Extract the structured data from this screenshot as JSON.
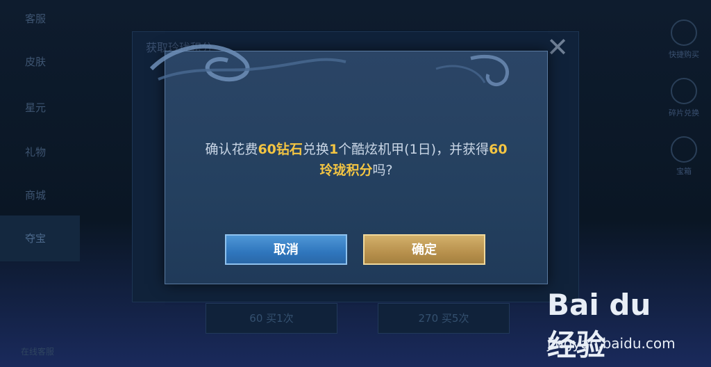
{
  "background": {
    "left_menu": [
      "客服",
      "皮肤",
      "星元",
      "礼物",
      "商城",
      "夺宝"
    ],
    "left_menu_active": "夺宝",
    "left_footer": "在线客服",
    "panel_title": "获取玲珑积分",
    "buttons": [
      "60 买1次",
      "270 买5次"
    ],
    "right_rail": [
      "快捷购买",
      "碎片兑换",
      "宝箱"
    ]
  },
  "dialog": {
    "message": {
      "p1": "确认花费",
      "v1": "60",
      "p2": "钻石",
      "p3": "兑换",
      "v2": "1",
      "p4": "个酷炫机甲(1日)，并获得",
      "v3": "60",
      "v4": "玲珑积分",
      "p5": "吗?"
    },
    "cancel_label": "取消",
    "confirm_label": "确定"
  },
  "watermark": {
    "brand": "Bai du 经验",
    "url": "jingyan.baidu.com"
  },
  "colors": {
    "highlight": "#f4c542",
    "cancel_button": "#3a82c7",
    "confirm_button": "#c19c57",
    "dialog_bg": "#27425f"
  }
}
